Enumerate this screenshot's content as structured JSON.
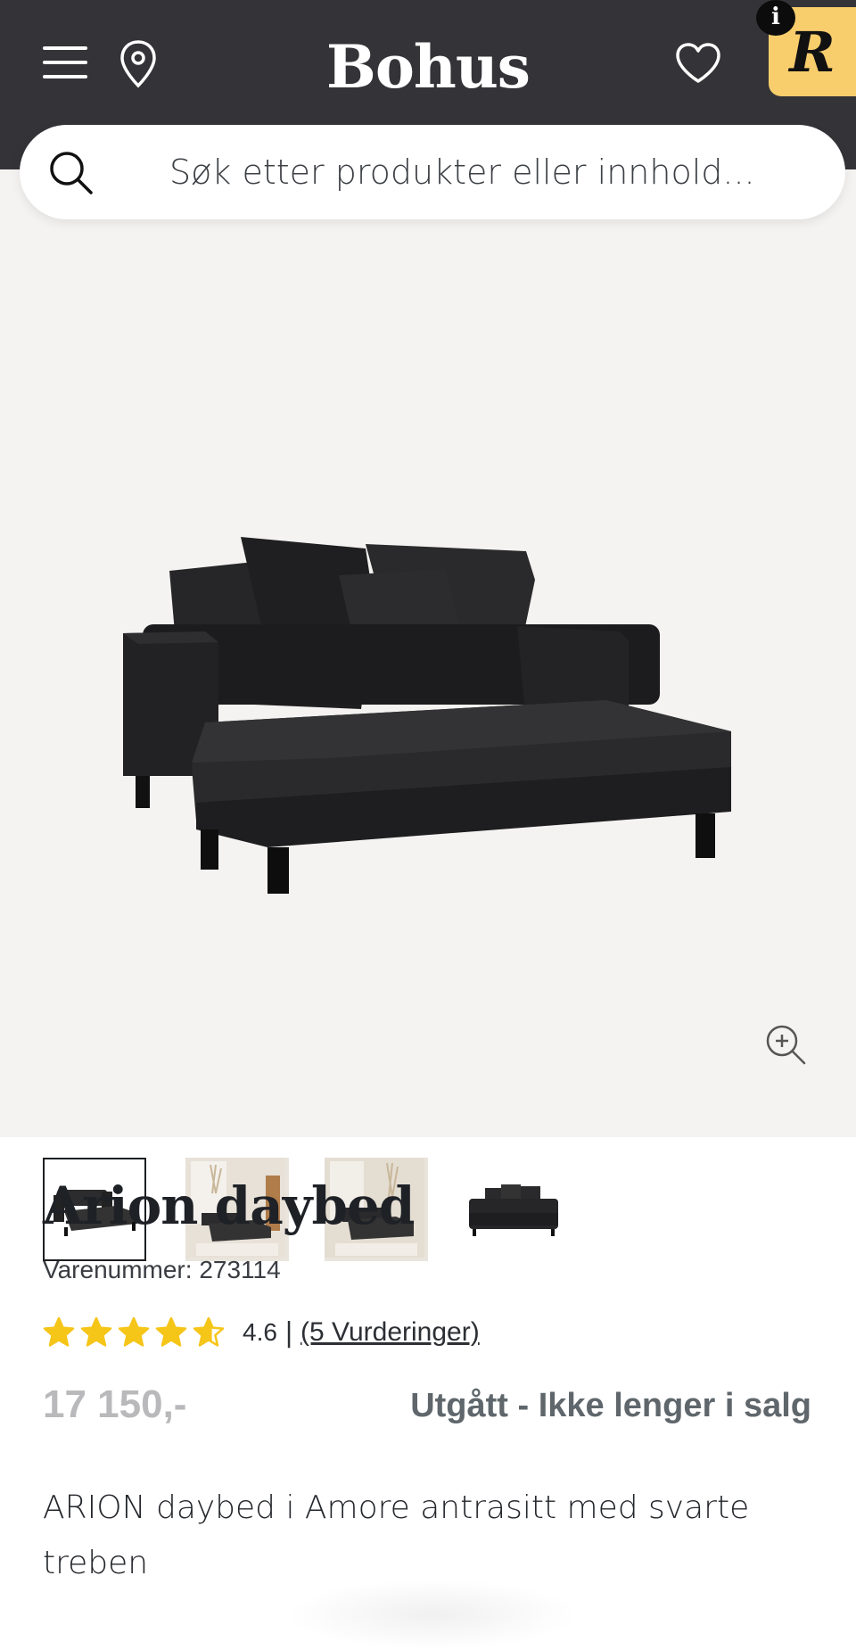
{
  "header": {
    "brand": "Bohus",
    "badge_letter": "R",
    "info_symbol": "i",
    "icons": [
      "menu-icon",
      "location-pin-icon",
      "heart-icon"
    ],
    "background_color": "#333338",
    "badge_color": "#f8cd6c"
  },
  "search": {
    "placeholder": "Søk etter produkter eller innhold..."
  },
  "gallery": {
    "thumbnail_count": 4,
    "active_index": 0,
    "zoom_icon": "zoom-in-icon"
  },
  "product": {
    "title": "Arion daybed",
    "sku": "Varenummer: 273114",
    "rating": {
      "value": 4.6,
      "max": 5,
      "value_label": "4.6",
      "separator": "|",
      "reviews_label": "(5 Vurderinger)",
      "star_color": "#f5c518"
    },
    "price": "17 150,-",
    "status": "Utgått - Ikke lenger i salg",
    "description": "ARION daybed i Amore antrasitt med svarte treben"
  }
}
